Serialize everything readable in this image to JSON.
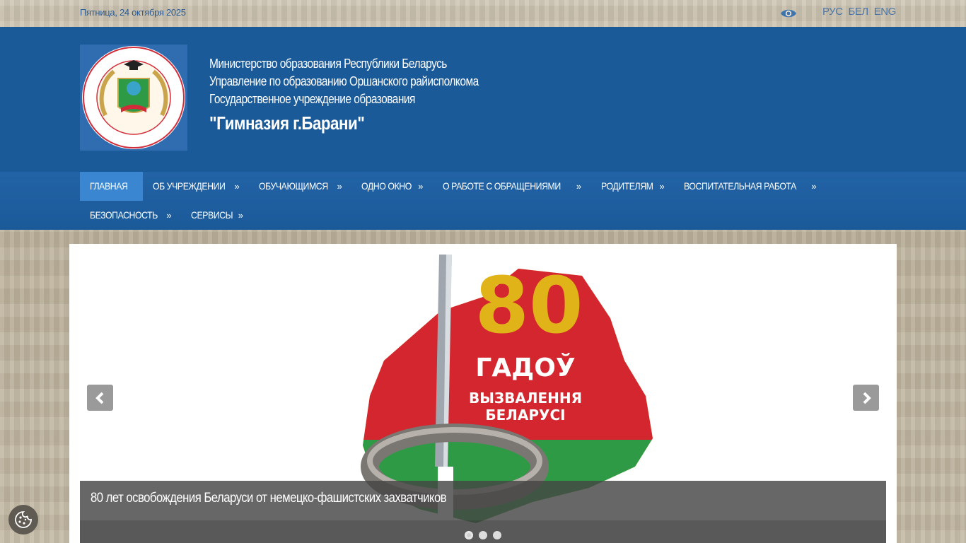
{
  "topbar": {
    "date": "Пятница, 24 октября 2025",
    "languages": [
      "РУС",
      "БЕЛ",
      "ENG"
    ]
  },
  "header": {
    "lines": [
      "Министерство образования Республики Беларусь",
      "Управление по образованию Оршанского райисполкома",
      "Государственное учреждение образования"
    ],
    "school_name": "\"Гимназия г.Барани\""
  },
  "nav": {
    "items": [
      {
        "label": "ГЛАВНАЯ",
        "arrow": ""
      },
      {
        "label": "ОБ УЧРЕЖДЕНИИ",
        "arrow": "»"
      },
      {
        "label": "ОБУЧАЮЩИМСЯ",
        "arrow": "»"
      },
      {
        "label": "ОДНО ОКНО",
        "arrow": "»"
      },
      {
        "label": "О РАБОТЕ С ОБРАЩЕНИЯМИ",
        "arrow": "»"
      },
      {
        "label": "РОДИТЕЛЯМ",
        "arrow": "»"
      },
      {
        "label": "ВОСПИТАТЕЛЬНАЯ РАБОТА",
        "arrow": "»"
      },
      {
        "label": "БЕЗОПАСНОСТЬ",
        "arrow": "»"
      },
      {
        "label": "СЕРВИСЫ",
        "arrow": "»"
      }
    ],
    "active_index": 0
  },
  "slider": {
    "poster": {
      "number": "80",
      "line1": "ГАДОЎ",
      "line2": "ВЫЗВАЛЕННЯ",
      "line3": "БЕЛАРУСІ"
    },
    "caption": "80 лет освобождения Беларуси от немецко-фашистских захватчиков",
    "slide_count": 3,
    "active_slide": 0
  },
  "colors": {
    "header_blue": "#1b5a99",
    "active_nav": "#3b86d0",
    "flag_red": "#d3262e",
    "flag_green": "#2f9a45",
    "gold": "#e0b418"
  },
  "icons": {
    "accessibility": "eye-icon",
    "prev": "chevron-left-icon",
    "next": "chevron-right-icon",
    "cookie": "cookie-icon"
  }
}
